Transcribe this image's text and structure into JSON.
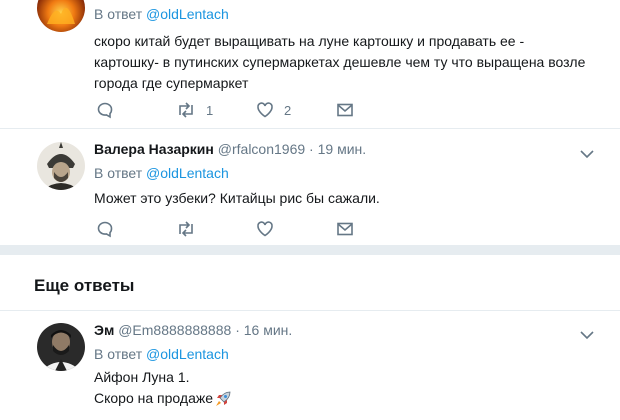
{
  "tweets": [
    {
      "reply_prefix": "В ответ",
      "reply_to": "@oldLentach",
      "text_lines": [
        "скоро китай будет выращивать на луне картошку  и продавать ее -",
        "картошку-  в путинских супермаркетах дешевле чем ту что выращена возле",
        "города  где супермаркет"
      ],
      "retweets": "1",
      "likes": "2",
      "avatar_icon": "fire-avatar"
    },
    {
      "name": "Валера Назаркин",
      "handle": "@rfalcon1969",
      "sep": "·",
      "time": "19 мин.",
      "reply_prefix": "В ответ",
      "reply_to": "@oldLentach",
      "text_lines": [
        "Может это узбеки?  Китайцы рис бы сажали."
      ],
      "avatar_icon": "warrior-avatar"
    },
    {
      "name": "Эм",
      "handle": "@Em8888888888",
      "sep": "·",
      "time": "16 мин.",
      "reply_prefix": "В ответ",
      "reply_to": "@oldLentach",
      "text_lines": [
        "Айфон Луна 1.",
        "Скоро на продаже"
      ],
      "emoji_icon": "rocket-icon",
      "avatar_icon": "person-avatar"
    }
  ],
  "more_replies_title": "Еще ответы",
  "colors": {
    "link": "#1b95e0",
    "muted": "#657786",
    "divider": "#e6ecf0"
  }
}
